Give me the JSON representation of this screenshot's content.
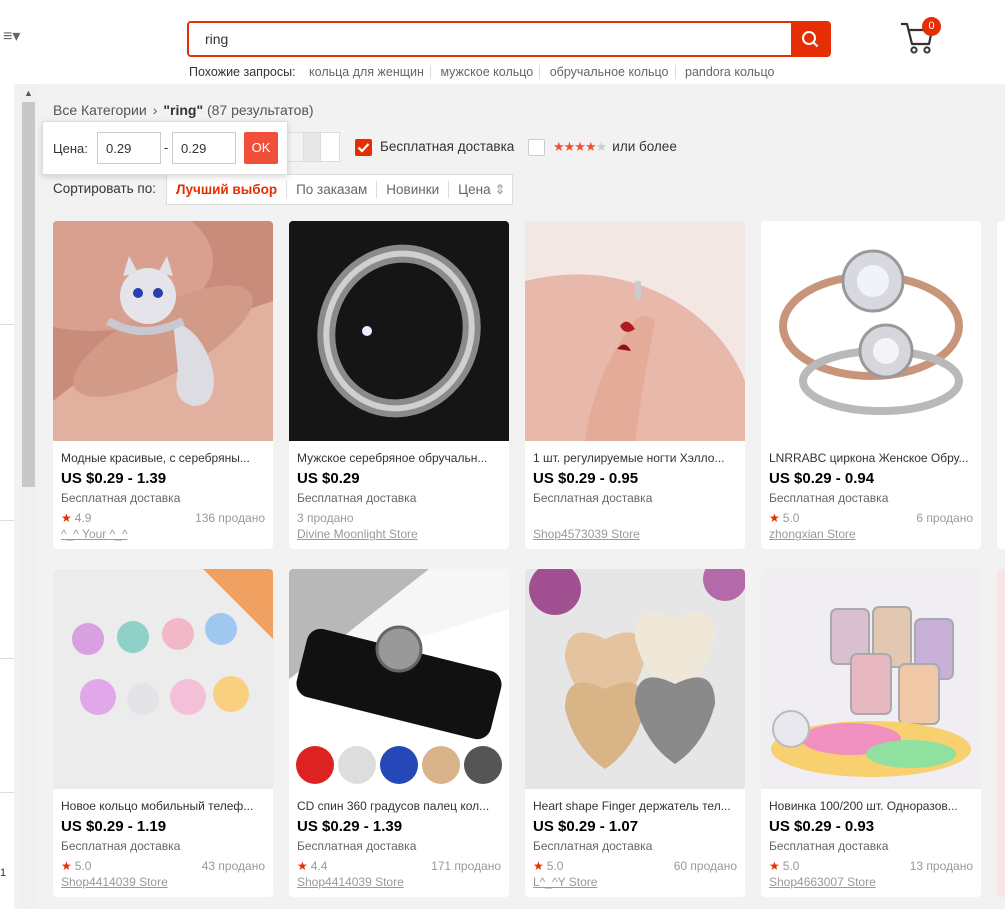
{
  "header": {
    "menu_icon": "hamburger-menu-icon",
    "search_value": "ring",
    "search_icon": "search-icon",
    "cart_icon": "shopping-cart-icon",
    "cart_count": "0",
    "related_label": "Похожие запросы:",
    "related": [
      "кольца для женщин",
      "мужское кольцо",
      "обручальное кольцо",
      "pandora кольцо"
    ]
  },
  "breadcrumb": {
    "all": "Все Категории",
    "sep": "›",
    "query": "\"ring\"",
    "count": "(87 результатов)"
  },
  "filters": {
    "price_label": "Цена:",
    "price_min": "0.29",
    "price_dash": "-",
    "price_max": "0.29",
    "ok": "OK",
    "free_shipping": "Бесплатная доставка",
    "free_shipping_checked": true,
    "rating_suffix": "или более",
    "rating_stars": 4
  },
  "sort": {
    "label": "Сортировать по:",
    "options": [
      "Лучший выбор",
      "По заказам",
      "Новинки",
      "Цена"
    ],
    "active": "Лучший выбор",
    "price_arrow": "⇕"
  },
  "products": [
    {
      "title": "Модные красивые, с серебряны...",
      "price": "US $0.29 - 1.39",
      "shipping": "Бесплатная доставка",
      "rating": "4.9",
      "sold": "136 продано",
      "store": "^_^ Your ^_^"
    },
    {
      "title": "Мужское серебряное обручальн...",
      "price": "US $0.29",
      "shipping": "Бесплатная доставка",
      "rating": "",
      "sold": "3 продано",
      "store": "Divine Moonlight Store"
    },
    {
      "title": "1 шт. регулируемые ногти Хэлло...",
      "price": "US $0.29 - 0.95",
      "shipping": "Бесплатная доставка",
      "rating": "",
      "sold": "",
      "store": "Shop4573039 Store"
    },
    {
      "title": "LNRRABC циркона Женское Обру...",
      "price": "US $0.29 - 0.94",
      "shipping": "Бесплатная доставка",
      "rating": "5.0",
      "sold": "6 продано",
      "store": "zhongxian Store"
    },
    {
      "title": "Новое кольцо мобильный телеф...",
      "price": "US $0.29 - 1.19",
      "shipping": "Бесплатная доставка",
      "rating": "5.0",
      "sold": "43 продано",
      "store": "Shop4414039 Store"
    },
    {
      "title": "CD спин 360 градусов палец кол...",
      "price": "US $0.29 - 1.39",
      "shipping": "Бесплатная доставка",
      "rating": "4.4",
      "sold": "171 продано",
      "store": "Shop4414039 Store"
    },
    {
      "title": "Heart shape Finger держатель тел...",
      "price": "US $0.29 - 1.07",
      "shipping": "Бесплатная доставка",
      "rating": "5.0",
      "sold": "60 продано",
      "store": "L^_^Y Store"
    },
    {
      "title": "Новинка 100/200 шт. Одноразов...",
      "price": "US $0.29 - 0.93",
      "shipping": "Бесплатная доставка",
      "rating": "5.0",
      "sold": "13 продано",
      "store": "Shop4663007 Store"
    }
  ],
  "side_mark": "1",
  "colors": {
    "accent": "#e62e04",
    "star": "#f0503a"
  }
}
